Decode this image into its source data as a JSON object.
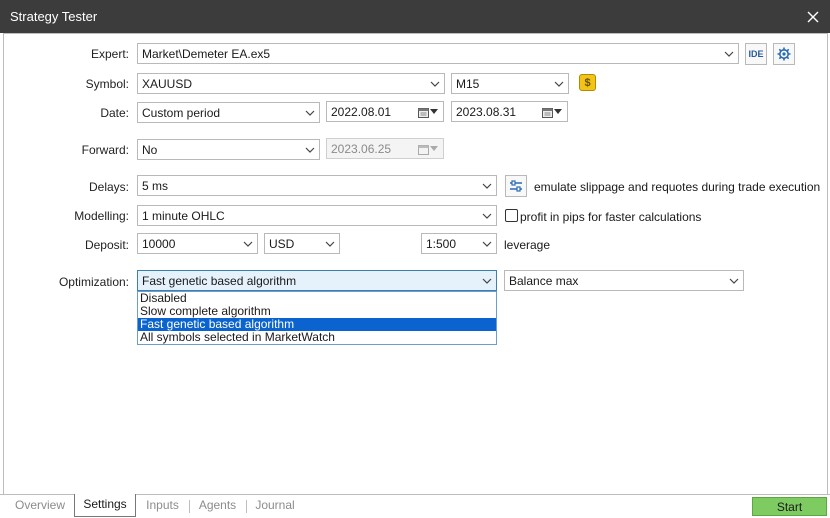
{
  "window": {
    "title": "Strategy Tester"
  },
  "labels": {
    "expert": "Expert:",
    "symbol": "Symbol:",
    "date": "Date:",
    "forward": "Forward:",
    "delays": "Delays:",
    "modelling": "Modelling:",
    "deposit": "Deposit:",
    "optimization": "Optimization:"
  },
  "expert": {
    "value": "Market\\Demeter EA.ex5",
    "ide_label": "IDE"
  },
  "symbol": {
    "value": "XAUUSD",
    "timeframe": "M15",
    "spec_button": "$"
  },
  "date": {
    "mode": "Custom period",
    "from": "2022.08.01",
    "to": "2023.08.31"
  },
  "forward": {
    "mode": "No",
    "date": "2023.06.25"
  },
  "delays": {
    "value": "5 ms",
    "emulate_text": "emulate slippage and requotes during trade execution"
  },
  "modelling": {
    "value": "1 minute OHLC",
    "pips_checkbox_label": "profit in pips for faster calculations",
    "pips_checked": false
  },
  "deposit": {
    "amount": "10000",
    "currency": "USD",
    "leverage_value": "1:500",
    "leverage_label": "leverage"
  },
  "optimization": {
    "value": "Fast genetic based algorithm",
    "criterion": "Balance max",
    "options": [
      "Disabled",
      "Slow complete algorithm",
      "Fast genetic based algorithm",
      "All symbols selected in MarketWatch"
    ],
    "selected_index": 2
  },
  "tabs": [
    "Overview",
    "Settings",
    "Inputs",
    "Agents",
    "Journal"
  ],
  "active_tab": "Settings",
  "start_button": "Start",
  "colors": {
    "titlebar": "#3c3c3c",
    "selection": "#0a63cf",
    "start": "#7ecb61",
    "dollar_badge": "#f2c418"
  }
}
